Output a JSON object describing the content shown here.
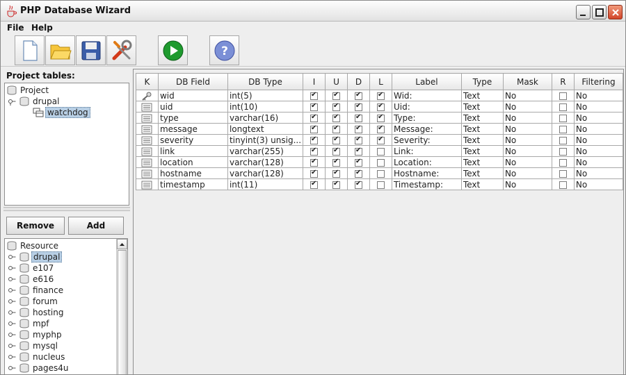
{
  "window": {
    "title": "PHP Database Wizard"
  },
  "menu": [
    {
      "label": "File"
    },
    {
      "label": "Help"
    }
  ],
  "left": {
    "project_label": "Project tables:",
    "project_tree": [
      {
        "label": "Project",
        "level": 0,
        "selected": false
      },
      {
        "label": "drupal",
        "level": 1,
        "selected": false
      },
      {
        "label": "watchdog",
        "level": 2,
        "selected": true
      }
    ],
    "remove_label": "Remove",
    "add_label": "Add",
    "resource_tree": [
      {
        "label": "Resource",
        "selected": false
      },
      {
        "label": "drupal",
        "selected": true
      },
      {
        "label": "e107",
        "selected": false
      },
      {
        "label": "e616",
        "selected": false
      },
      {
        "label": "finance",
        "selected": false
      },
      {
        "label": "forum",
        "selected": false
      },
      {
        "label": "hosting",
        "selected": false
      },
      {
        "label": "mpf",
        "selected": false
      },
      {
        "label": "myphp",
        "selected": false
      },
      {
        "label": "mysql",
        "selected": false
      },
      {
        "label": "nucleus",
        "selected": false
      },
      {
        "label": "pages4u",
        "selected": false
      }
    ]
  },
  "table": {
    "headers": [
      "K",
      "DB Field",
      "DB Type",
      "I",
      "U",
      "D",
      "L",
      "Label",
      "Type",
      "Mask",
      "R",
      "Filtering"
    ],
    "rows": [
      {
        "key": true,
        "field": "wid",
        "type": "int(5)",
        "i": true,
        "u": true,
        "d": true,
        "l": true,
        "label": "Wid:",
        "vtype": "Text",
        "mask": "No",
        "r": false,
        "filter": "No"
      },
      {
        "key": false,
        "field": "uid",
        "type": "int(10)",
        "i": true,
        "u": true,
        "d": true,
        "l": true,
        "label": "Uid:",
        "vtype": "Text",
        "mask": "No",
        "r": false,
        "filter": "No"
      },
      {
        "key": false,
        "field": "type",
        "type": "varchar(16)",
        "i": true,
        "u": true,
        "d": true,
        "l": true,
        "label": "Type:",
        "vtype": "Text",
        "mask": "No",
        "r": false,
        "filter": "No"
      },
      {
        "key": false,
        "field": "message",
        "type": "longtext",
        "i": true,
        "u": true,
        "d": true,
        "l": true,
        "label": "Message:",
        "vtype": "Text",
        "mask": "No",
        "r": false,
        "filter": "No"
      },
      {
        "key": false,
        "field": "severity",
        "type": "tinyint(3) unsig...",
        "i": true,
        "u": true,
        "d": true,
        "l": true,
        "label": "Severity:",
        "vtype": "Text",
        "mask": "No",
        "r": false,
        "filter": "No"
      },
      {
        "key": false,
        "field": "link",
        "type": "varchar(255)",
        "i": true,
        "u": true,
        "d": true,
        "l": false,
        "label": "Link:",
        "vtype": "Text",
        "mask": "No",
        "r": false,
        "filter": "No"
      },
      {
        "key": false,
        "field": "location",
        "type": "varchar(128)",
        "i": true,
        "u": true,
        "d": true,
        "l": false,
        "label": "Location:",
        "vtype": "Text",
        "mask": "No",
        "r": false,
        "filter": "No"
      },
      {
        "key": false,
        "field": "hostname",
        "type": "varchar(128)",
        "i": true,
        "u": true,
        "d": true,
        "l": false,
        "label": "Hostname:",
        "vtype": "Text",
        "mask": "No",
        "r": false,
        "filter": "No"
      },
      {
        "key": false,
        "field": "timestamp",
        "type": "int(11)",
        "i": true,
        "u": true,
        "d": true,
        "l": false,
        "label": "Timestamp:",
        "vtype": "Text",
        "mask": "No",
        "r": false,
        "filter": "No"
      }
    ]
  },
  "icons": {
    "toolbar": [
      "new-file-icon",
      "open-folder-icon",
      "save-icon",
      "tools-icon",
      "run-icon",
      "help-icon"
    ],
    "row_key": "key-icon",
    "row_field": "field-icon"
  },
  "colors": {
    "selection": "#b8cfe5",
    "run_green": "#1e9a2e",
    "help_blue": "#7b8fd6"
  }
}
